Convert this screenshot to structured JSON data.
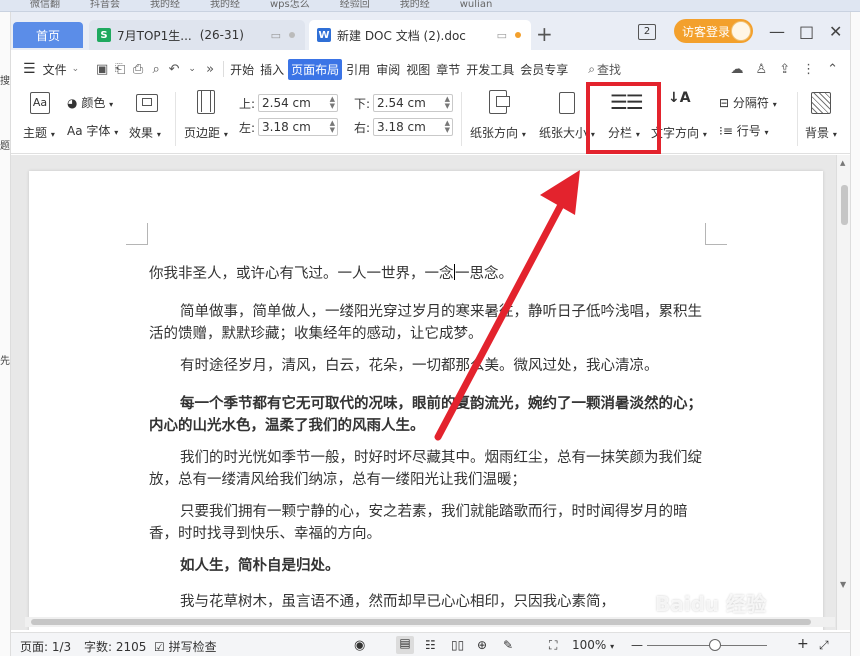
{
  "browser_tabs": [
    "微信翻",
    "抖音会",
    "我的经",
    "我的经",
    "wps怎么",
    "经验回",
    "我的经",
    "wulian"
  ],
  "left_fragments": [
    "搜",
    "题",
    "先"
  ],
  "tabs": {
    "home": "首页",
    "sheet_title": "7月TOP1生...",
    "sheet_range": "(26-31)",
    "doc_title": "新建 DOC 文档 (2).doc",
    "add": "+"
  },
  "window": {
    "badge": "2",
    "login_label": "访客登录",
    "minimize": "—",
    "maximize": "□",
    "close": "✕"
  },
  "menu": {
    "file": "文件",
    "items": [
      "开始",
      "插入",
      "页面布局",
      "引用",
      "审阅",
      "视图",
      "章节",
      "开发工具",
      "会员专享"
    ],
    "active_index": 2,
    "search": "查找"
  },
  "ribbon": {
    "theme": "主题",
    "color": "颜色",
    "font": "字体",
    "effect": "效果",
    "margins": "页边距",
    "top_label": "上:",
    "top_value": "2.54 cm",
    "bottom_label": "下:",
    "bottom_value": "2.54 cm",
    "left_label": "左:",
    "left_value": "3.18 cm",
    "right_label": "右:",
    "right_value": "3.18 cm",
    "orientation": "纸张方向",
    "paper_size": "纸张大小",
    "columns": "分栏",
    "text_direction": "文字方向",
    "separator": "分隔符",
    "line_numbers": "行号",
    "background": "背景"
  },
  "document": {
    "paragraphs": [
      {
        "text": "你我非圣人，或许心有飞过。一人一世界，一念一思念。",
        "bold": false,
        "indent": false
      },
      {
        "text": "简单做事，简单做人，一缕阳光穿过岁月的寒来暑往，静听日子低吟浅唱，累积生活的馈赠，默默珍藏；收集经年的感动，让它成梦。",
        "bold": false,
        "indent": true
      },
      {
        "text": "有时途径岁月，清风，白云，花朵，一切都那么美。微风过处，我心清凉。",
        "bold": false,
        "indent": true
      },
      {
        "text": "每一个季节都有它无可取代的况味，眼前的夏韵流光，婉约了一颗消暑淡然的心；内心的山光水色，温柔了我们的风雨人生。",
        "bold": true,
        "indent": true
      },
      {
        "text": "我们的时光恍如季节一般，时好时坏尽藏其中。烟雨红尘，总有一抹笑颜为我们绽放，总有一缕清风给我们纳凉，总有一缕阳光让我们温暖；",
        "bold": false,
        "indent": true
      },
      {
        "text": "只要我们拥有一颗宁静的心，安之若素，我们就能踏歌而行，时时闻得岁月的暗香，时时找寻到快乐、幸福的方向。",
        "bold": false,
        "indent": true
      },
      {
        "text": "如人生，简朴自是归处。",
        "bold": true,
        "indent": true
      },
      {
        "text": "我与花草树木，虽言语不通，然而却早已心心相印，只因我心素简，",
        "bold": false,
        "indent": true
      }
    ]
  },
  "status": {
    "page": "页面: 1/3",
    "words": "字数: 2105",
    "spell": "拼写检查",
    "zoom": "100%",
    "zoom_minus": "—",
    "zoom_plus": "+"
  },
  "watermark": "Baidu 经验",
  "colors": {
    "accent": "#3b74e6",
    "home_tab": "#5b8de8",
    "login": "#f3a02c",
    "highlight": "#e3232d"
  }
}
